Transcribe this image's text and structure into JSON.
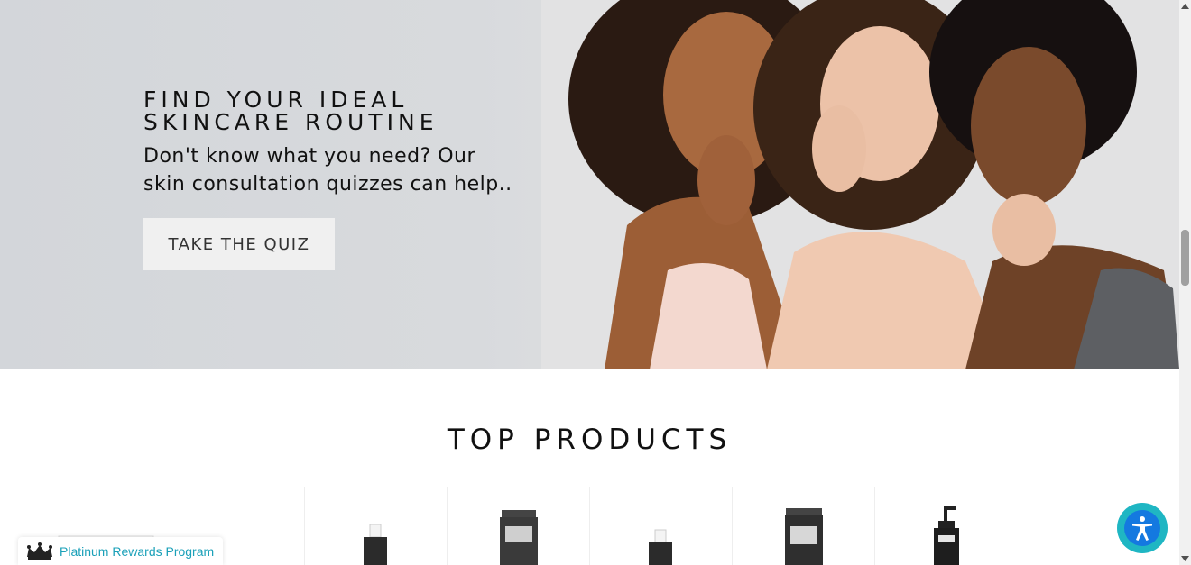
{
  "hero": {
    "title": "FIND YOUR IDEAL SKINCARE ROUTINE",
    "subtitle": "Don't know what you need? Our skin consultation quizzes can help..",
    "cta_label": "TAKE THE QUIZ"
  },
  "products": {
    "title": "TOP PRODUCTS"
  },
  "rewards": {
    "label": "Platinum Rewards Program",
    "icon": "crown-icon"
  },
  "accessibility": {
    "icon": "accessibility-icon",
    "color": "#1fb6c3"
  },
  "colors": {
    "accent": "#1aa0b8",
    "hero_bg": "#d8dadd"
  }
}
